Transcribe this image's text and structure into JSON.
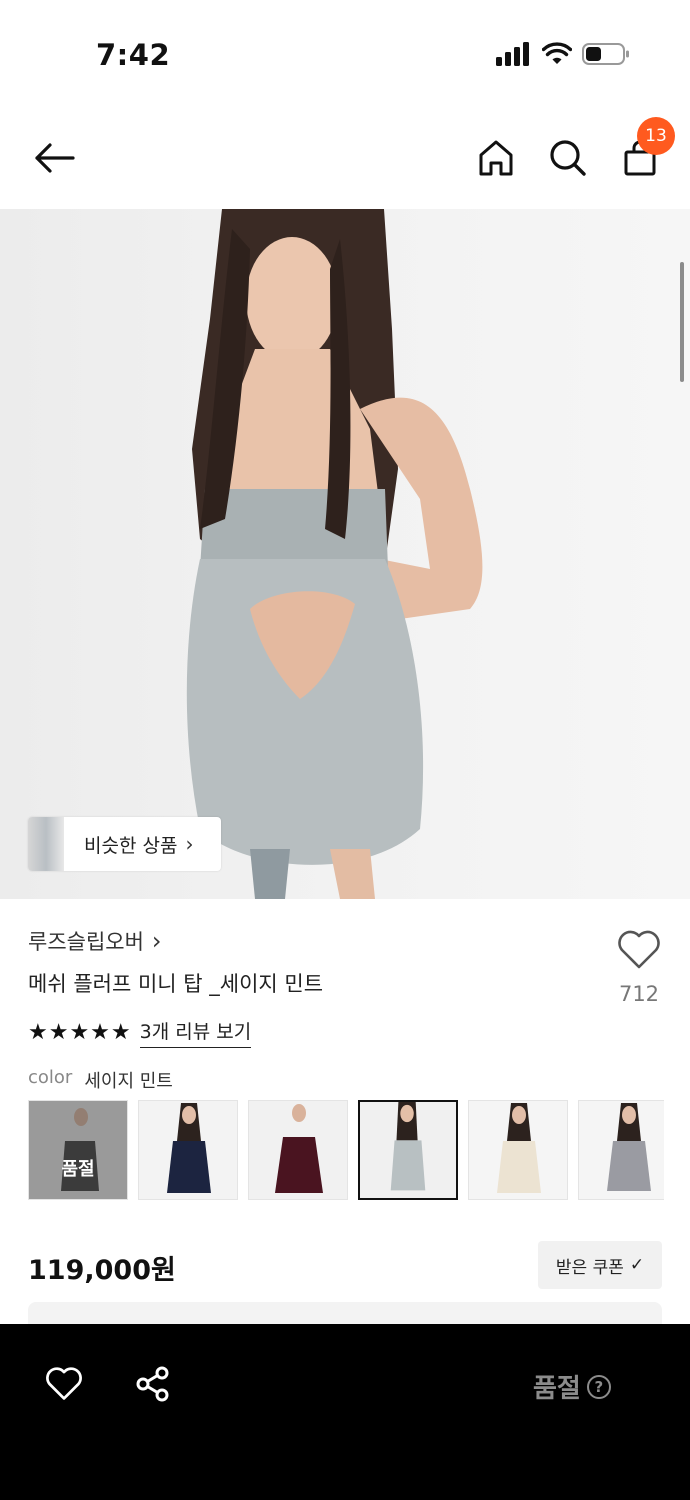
{
  "status_bar": {
    "time": "7:42",
    "icons": [
      "signal-icon",
      "wifi-icon",
      "battery-icon"
    ]
  },
  "header": {
    "back_icon": "back-arrow-icon",
    "home_icon": "home-icon",
    "search_icon": "search-icon",
    "cart_icon": "shopping-bag-icon",
    "cart_count": "13"
  },
  "hero": {
    "similar_label": "비슷한 상품",
    "similar_chevron": "›"
  },
  "product": {
    "brand": "루즈슬립오버",
    "brand_chevron": "›",
    "title": "메쉬 플러프 미니 탑 _세이지 민트",
    "likes": "712",
    "stars": "★★★★★",
    "review_link": "3개 리뷰 보기",
    "color_key": "color",
    "color_value": "세이지 민트",
    "swatches": [
      {
        "label": "품절",
        "sold_out": true
      },
      {
        "label": "",
        "sold_out": false
      },
      {
        "label": "",
        "sold_out": false
      },
      {
        "label": "",
        "sold_out": false,
        "selected": true
      },
      {
        "label": "",
        "sold_out": false
      },
      {
        "label": "",
        "sold_out": false
      }
    ],
    "price": "119,000원",
    "coupon_label": "받은 쿠폰",
    "coupon_check": "✓"
  },
  "bottom_bar": {
    "wishlist_icon": "heart-icon",
    "share_icon": "share-icon",
    "soldout_label": "품절",
    "help_glyph": "?"
  },
  "colors": {
    "accent_badge": "#ff5a1f",
    "bottom_bar_bg": "#000000",
    "disabled_text": "#8c8c8c"
  }
}
